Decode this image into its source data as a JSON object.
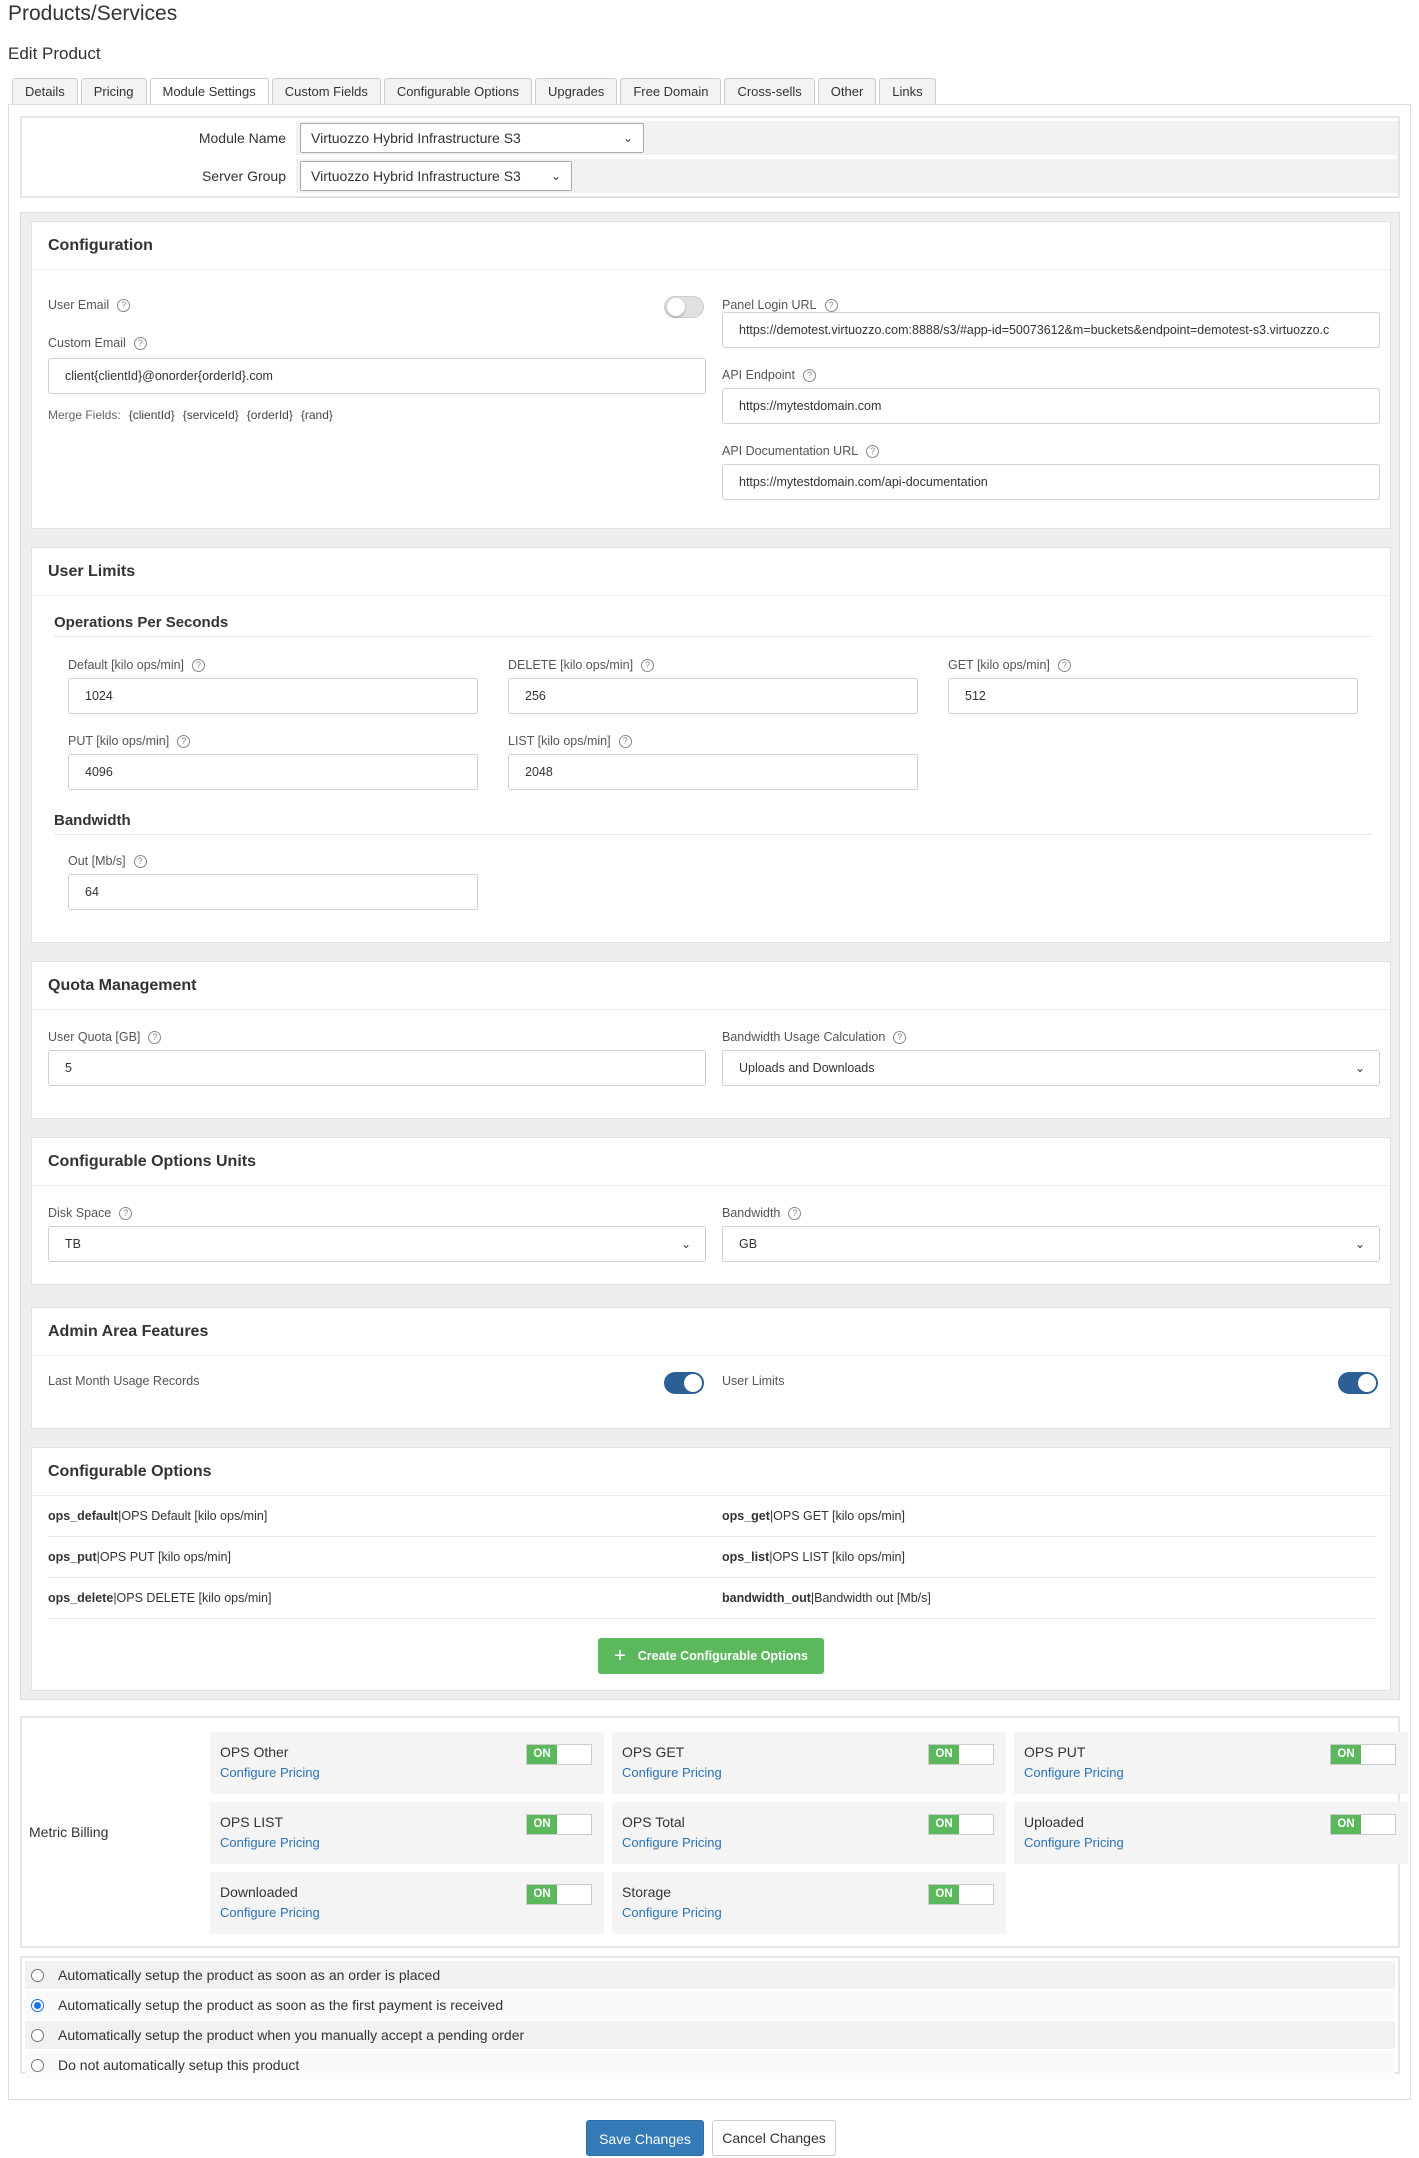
{
  "header": {
    "title": "Products/Services",
    "subtitle": "Edit Product"
  },
  "tabs": [
    "Details",
    "Pricing",
    "Module Settings",
    "Custom Fields",
    "Configurable Options",
    "Upgrades",
    "Free Domain",
    "Cross-sells",
    "Other",
    "Links"
  ],
  "active_tab": "Module Settings",
  "module": {
    "module_name_label": "Module Name",
    "module_name_value": "Virtuozzo Hybrid Infrastructure S3",
    "server_group_label": "Server Group",
    "server_group_value": "Virtuozzo Hybrid Infrastructure S3"
  },
  "configuration": {
    "title": "Configuration",
    "user_email_label": "User Email",
    "custom_email_label": "Custom Email",
    "custom_email_value": "client{clientId}@onorder{orderId}.com",
    "merge_label": "Merge Fields:",
    "merge_fields": [
      "{clientId}",
      "{serviceId}",
      "{orderId}",
      "{rand}"
    ],
    "panel_login_label": "Panel Login URL",
    "panel_login_value": "https://demotest.virtuozzo.com:8888/s3/#app-id=50073612&m=buckets&endpoint=demotest-s3.virtuozzo.c",
    "api_endpoint_label": "API Endpoint",
    "api_endpoint_value": "https://mytestdomain.com",
    "api_doc_label": "API Documentation URL",
    "api_doc_value": "https://mytestdomain.com/api-documentation"
  },
  "user_limits": {
    "title": "User Limits",
    "ops_title": "Operations Per Seconds",
    "default_label": "Default [kilo ops/min]",
    "default_value": "1024",
    "delete_label": "DELETE [kilo ops/min]",
    "delete_value": "256",
    "get_label": "GET [kilo ops/min]",
    "get_value": "512",
    "put_label": "PUT [kilo ops/min]",
    "put_value": "4096",
    "list_label": "LIST [kilo ops/min]",
    "list_value": "2048",
    "bw_title": "Bandwidth",
    "out_label": "Out [Mb/s]",
    "out_value": "64"
  },
  "quota": {
    "title": "Quota Management",
    "user_quota_label": "User Quota [GB]",
    "user_quota_value": "5",
    "bw_calc_label": "Bandwidth Usage Calculation",
    "bw_calc_value": "Uploads and Downloads"
  },
  "units": {
    "title": "Configurable Options Units",
    "disk_label": "Disk Space",
    "disk_value": "TB",
    "bw_label": "Bandwidth",
    "bw_value": "GB"
  },
  "admin": {
    "title": "Admin Area Features",
    "last_month_label": "Last Month Usage Records",
    "user_limits_label": "User Limits"
  },
  "config_options": {
    "title": "Configurable Options",
    "rows": [
      [
        {
          "key": "ops_default",
          "label": "|OPS Default [kilo ops/min]"
        },
        {
          "key": "ops_get",
          "label": "|OPS GET [kilo ops/min]"
        }
      ],
      [
        {
          "key": "ops_put",
          "label": "|OPS PUT [kilo ops/min]"
        },
        {
          "key": "ops_list",
          "label": "|OPS LIST [kilo ops/min]"
        }
      ],
      [
        {
          "key": "ops_delete",
          "label": "|OPS DELETE [kilo ops/min]"
        },
        {
          "key": "bandwidth_out",
          "label": "|Bandwidth out [Mb/s]"
        }
      ]
    ],
    "create_button": "Create Configurable Options"
  },
  "metric_billing": {
    "label": "Metric Billing",
    "on_label": "ON",
    "link_label": "Configure Pricing",
    "items": [
      "OPS Other",
      "OPS GET",
      "OPS PUT",
      "OPS LIST",
      "OPS Total",
      "Uploaded",
      "Downloaded",
      "Storage"
    ]
  },
  "setup_options": [
    "Automatically setup the product as soon as an order is placed",
    "Automatically setup the product as soon as the first payment is received",
    "Automatically setup the product when you manually accept a pending order",
    "Do not automatically setup this product"
  ],
  "selected_setup": 1,
  "buttons": {
    "save": "Save Changes",
    "cancel": "Cancel Changes"
  },
  "colors": {
    "primary": "#337ab7",
    "green": "#5cb85c",
    "toggle_on": "#2b5f95",
    "link": "#2a72b5"
  }
}
